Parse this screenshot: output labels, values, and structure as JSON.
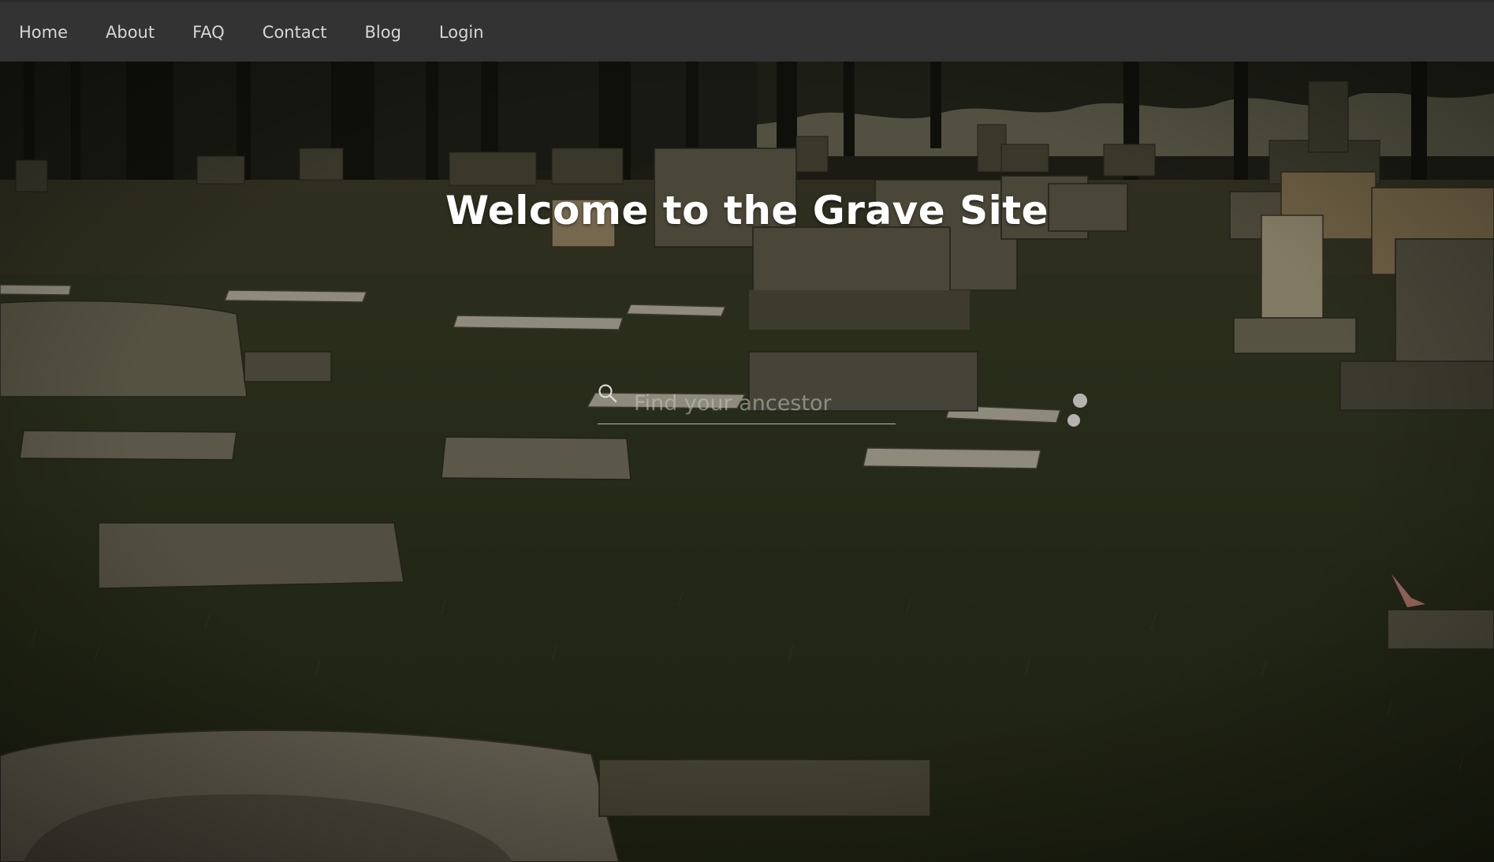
{
  "nav": {
    "items": [
      {
        "label": "Home"
      },
      {
        "label": "About"
      },
      {
        "label": "FAQ"
      },
      {
        "label": "Contact"
      },
      {
        "label": "Blog"
      },
      {
        "label": "Login"
      }
    ]
  },
  "hero": {
    "title": "Welcome to the Grave Site",
    "background": "cemetery-photo"
  },
  "search": {
    "placeholder": "Find your ancestor",
    "value": "",
    "icon": "search-icon"
  },
  "colors": {
    "navbar": "#333333",
    "nav_text": "#d6d6d6",
    "title_text": "#ffffff"
  }
}
